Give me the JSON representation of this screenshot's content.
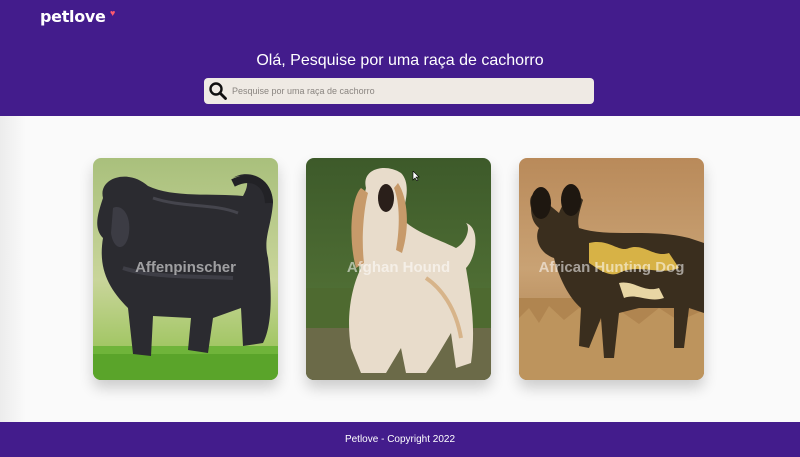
{
  "header": {
    "logo": "petlove",
    "logo_heart": "♥",
    "headline": "Olá, Pesquise por uma raça de cachorro",
    "background": "#431c8c"
  },
  "search": {
    "placeholder": "Pesquise por uma raça de cachorro",
    "value": "",
    "icon": "search-icon"
  },
  "breeds": [
    {
      "name": "Affenpinscher"
    },
    {
      "name": "Afghan Hound"
    },
    {
      "name": "African Hunting Dog"
    }
  ],
  "footer": {
    "text": "Petlove - Copyright 2022"
  }
}
